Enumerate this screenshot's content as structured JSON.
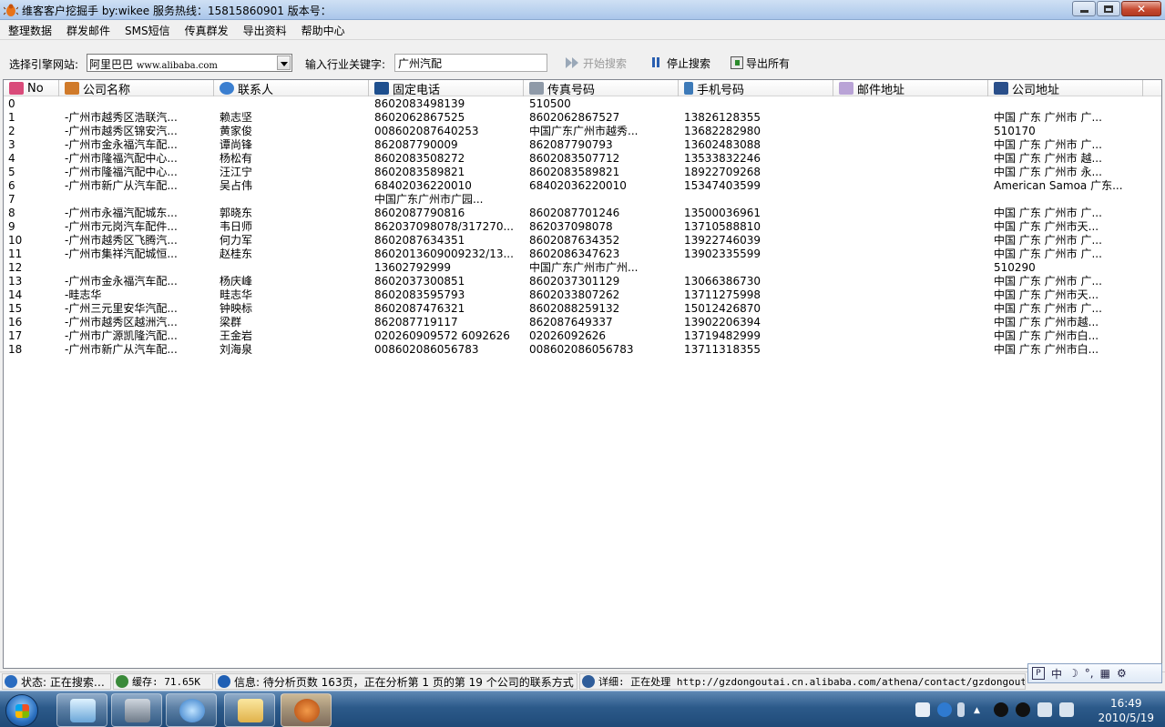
{
  "window": {
    "title": "维客客户挖掘手 by:wikee 服务热线：15815860901 版本号："
  },
  "menu": [
    "整理数据",
    "群发邮件",
    "SMS短信",
    "传真群发",
    "导出资料",
    "帮助中心"
  ],
  "toolbar": {
    "engine_label": "选择引擎网站:",
    "engine_name": "阿里巴巴",
    "engine_url": "www.alibaba.com",
    "keyword_label": "输入行业关键字:",
    "keyword_value": "广州汽配",
    "start_label": "开始搜索",
    "stop_label": "停止搜索",
    "export_label": "导出所有"
  },
  "table": {
    "columns": [
      "No",
      "公司名称",
      "联系人",
      "固定电话",
      "传真号码",
      "手机号码",
      "邮件地址",
      "公司地址"
    ],
    "rows": [
      [
        "0",
        "",
        "",
        "8602083498139",
        "510500",
        "",
        "",
        ""
      ],
      [
        "1",
        "-广州市越秀区浩联汽...",
        "赖志坚",
        "8602062867525",
        "8602062867527",
        "13826128355",
        "",
        "中国 广东 广州市 广..."
      ],
      [
        "2",
        "-广州市越秀区锦安汽...",
        "黄家俊",
        "008602087640253",
        "中国广东广州市越秀...",
        "13682282980",
        "",
        "510170"
      ],
      [
        "3",
        "-广州市金永福汽车配...",
        "谭尚锋",
        "862087790009",
        "862087790793",
        "13602483088",
        "",
        "中国 广东 广州市 广..."
      ],
      [
        "4",
        "-广州市隆福汽配中心...",
        "杨松有",
        "8602083508272",
        "8602083507712",
        "13533832246",
        "",
        "中国 广东 广州市 越..."
      ],
      [
        "5",
        "-广州市隆福汽配中心...",
        "汪江宁",
        "8602083589821",
        "8602083589821",
        "18922709268",
        "",
        "中国 广东 广州市 永..."
      ],
      [
        "6",
        "-广州市新广从汽车配...",
        "吴占伟",
        "68402036220010",
        "68402036220010",
        "15347403599",
        "",
        "American Samoa 广东..."
      ],
      [
        "7",
        "",
        "",
        "中国广东广州市广园...",
        "",
        "",
        "",
        ""
      ],
      [
        "8",
        "-广州市永福汽配城东...",
        "郭晓东",
        "8602087790816",
        "8602087701246",
        "13500036961",
        "",
        "中国 广东 广州市 广..."
      ],
      [
        "9",
        "-广州市元岗汽车配件...",
        "韦日师",
        "862037098078/317270...",
        "862037098078",
        "13710588810",
        "",
        "中国 广东 广州市天..."
      ],
      [
        "10",
        "-广州市越秀区飞腾汽...",
        "何力军",
        "8602087634351",
        "8602087634352",
        "13922746039",
        "",
        "中国 广东 广州市 广..."
      ],
      [
        "11",
        "-广州市集祥汽配城恒...",
        "赵桂东",
        "8602013609009232/13...",
        "8602086347623",
        "13902335599",
        "",
        "中国 广东 广州市 广..."
      ],
      [
        "12",
        "",
        "",
        "13602792999",
        "中国广东广州市广州...",
        "",
        "",
        "510290"
      ],
      [
        "13",
        "-广州市金永福汽车配...",
        "杨庆峰",
        "8602037300851",
        "8602037301129",
        "13066386730",
        "",
        "中国 广东 广州市 广..."
      ],
      [
        "14",
        "-畦志华",
        "畦志华",
        "8602083595793",
        "8602033807262",
        "13711275998",
        "",
        "中国 广东 广州市天..."
      ],
      [
        "15",
        "-广州三元里安华汽配...",
        "钟映标",
        "8602087476321",
        "8602088259132",
        "15012426870",
        "",
        "中国 广东 广州市 广..."
      ],
      [
        "16",
        "-广州市越秀区越洲汽...",
        "梁群",
        "862087719117",
        "862087649337",
        "13902206394",
        "",
        "中国 广东 广州市越..."
      ],
      [
        "17",
        "-广州市广源凯隆汽配...",
        "王金岩",
        "020260909572 6092626",
        "02026092626",
        "13719482999",
        "",
        "中国 广东 广州市白..."
      ],
      [
        "18",
        "-广州市新广从汽车配...",
        "刘海泉",
        "008602086056783",
        "008602086056783",
        "13711318355",
        "",
        "中国 广东 广州市白..."
      ]
    ]
  },
  "status": {
    "state": "状态: 正在搜索…",
    "cache": "缓存: 71.65K",
    "info": "信息: 待分析页数 163页，正在分析第 1 页的第 19 个公司的联系方式",
    "detail": "详细: 正在处理 http://gzdongoutai.cn.alibaba.com/athena/contact/gzdongoutai.html"
  },
  "ime": [
    "中",
    "简"
  ],
  "taskbar": {
    "time": "16:49",
    "date": "2010/5/19"
  },
  "colors": {
    "titlebar": "#b9d1ee",
    "taskbar": "#2c5a8a",
    "close_button": "#c74a31"
  }
}
